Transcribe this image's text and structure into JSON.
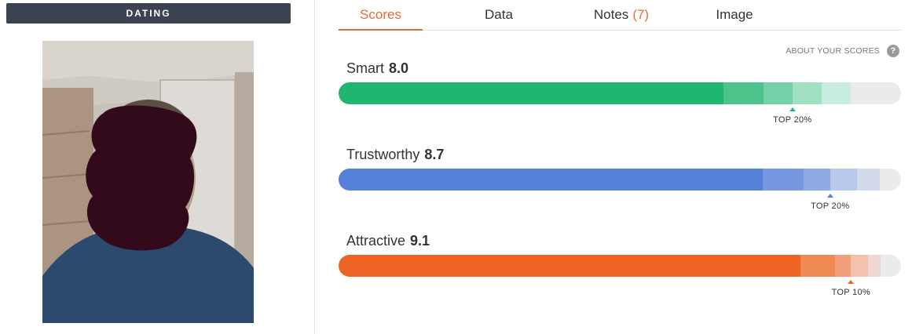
{
  "category": {
    "label": "DATING"
  },
  "tabs": [
    {
      "label": "Scores",
      "active": true
    },
    {
      "label": "Data",
      "active": false
    },
    {
      "label": "Notes",
      "count": "(7)",
      "active": false
    },
    {
      "label": "Image",
      "active": false
    }
  ],
  "about": {
    "label": "ABOUT YOUR SCORES",
    "icon": "help-icon"
  },
  "metrics": [
    {
      "name": "Smart",
      "score": "8.0",
      "percentile_label": "TOP 20%",
      "color": "#21b670",
      "fill_fraction": 0.684,
      "band_fractions": [
        0.755,
        0.807,
        0.859,
        0.911
      ],
      "band_colors": [
        "#4cc38b",
        "#74d0a6",
        "#a2e0c3",
        "#c9ece0"
      ],
      "marker_fraction": 0.807
    },
    {
      "name": "Trustworthy",
      "score": "8.7",
      "percentile_label": "TOP 20%",
      "color": "#5580d8",
      "fill_fraction": 0.754,
      "band_fractions": [
        0.827,
        0.874,
        0.922,
        0.962
      ],
      "band_colors": [
        "#7798e0",
        "#90aae4",
        "#b8c9ec",
        "#d3daea"
      ],
      "marker_fraction": 0.874
    },
    {
      "name": "Attractive",
      "score": "9.1",
      "percentile_label": "TOP 10%",
      "color": "#ee6425",
      "fill_fraction": 0.821,
      "band_fractions": [
        0.882,
        0.911,
        0.941,
        0.964
      ],
      "band_colors": [
        "#f08a55",
        "#f1a07b",
        "#f2c2ad",
        "#efd8d1"
      ],
      "marker_fraction": 0.911
    }
  ]
}
